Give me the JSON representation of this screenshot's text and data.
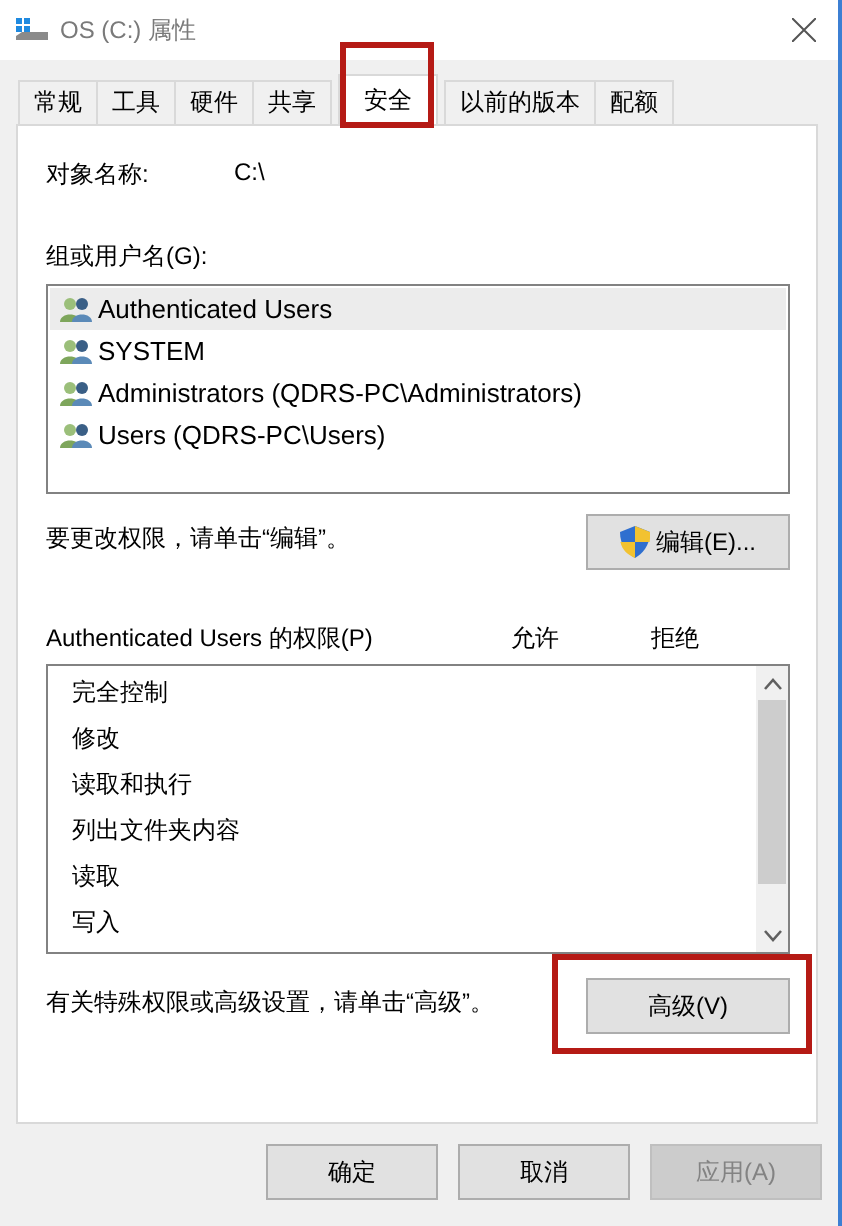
{
  "window": {
    "title": "OS (C:) 属性"
  },
  "tabs": [
    {
      "label": "常规",
      "selected": false,
      "highlighted": false
    },
    {
      "label": "工具",
      "selected": false,
      "highlighted": false
    },
    {
      "label": "硬件",
      "selected": false,
      "highlighted": false
    },
    {
      "label": "共享",
      "selected": false,
      "highlighted": false
    },
    {
      "label": "安全",
      "selected": true,
      "highlighted": true
    },
    {
      "label": "以前的版本",
      "selected": false,
      "highlighted": false
    },
    {
      "label": "配额",
      "selected": false,
      "highlighted": false
    }
  ],
  "object_name": {
    "label": "对象名称:",
    "value": "C:\\"
  },
  "groups": {
    "label": "组或用户名(G):",
    "items": [
      {
        "name": "Authenticated Users",
        "selected": true
      },
      {
        "name": "SYSTEM",
        "selected": false
      },
      {
        "name": "Administrators (QDRS-PC\\Administrators)",
        "selected": false
      },
      {
        "name": "Users (QDRS-PC\\Users)",
        "selected": false
      }
    ]
  },
  "edit_hint": "要更改权限，请单击“编辑”。",
  "edit_button": "编辑(E)...",
  "permissions": {
    "label": "Authenticated Users 的权限(P)",
    "columns": [
      "允许",
      "拒绝"
    ],
    "items": [
      "完全控制",
      "修改",
      "读取和执行",
      "列出文件夹内容",
      "读取",
      "写入"
    ]
  },
  "advanced_hint": "有关特殊权限或高级设置，请单击“高级”。",
  "advanced_button": {
    "label": "高级(V)",
    "highlighted": true
  },
  "buttons": [
    {
      "label": "确定",
      "disabled": false
    },
    {
      "label": "取消",
      "disabled": false
    },
    {
      "label": "应用(A)",
      "disabled": true
    }
  ]
}
